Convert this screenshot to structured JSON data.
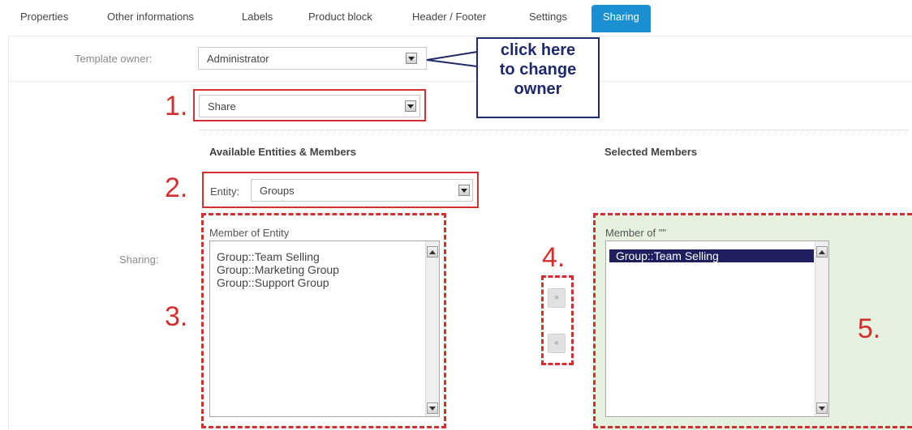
{
  "tabs": [
    "Properties",
    "Other informations",
    "Labels",
    "Product block",
    "Header / Footer",
    "Settings",
    "Sharing"
  ],
  "owner": {
    "label": "Template owner:",
    "value": "Administrator"
  },
  "callout": {
    "line1": "click here",
    "line2": "to change",
    "line3": "owner"
  },
  "share_select": {
    "value": "Share"
  },
  "available": {
    "heading": "Available Entities & Members"
  },
  "selected": {
    "heading": "Selected Members"
  },
  "entity": {
    "label": "Entity:",
    "value": "Groups"
  },
  "sharing_label": "Sharing:",
  "member_of_entity": {
    "label": "Member of Entity",
    "items": [
      "Group::Team Selling",
      "Group::Marketing Group",
      "Group::Support Group"
    ]
  },
  "member_of_selected": {
    "label": "Member of \"\"",
    "items": [
      "Group::Team Selling"
    ]
  },
  "move_buttons": {
    "add": "»",
    "remove": "«"
  },
  "annotations": {
    "n1": "1.",
    "n2": "2.",
    "n3": "3.",
    "n4": "4.",
    "n5": "5."
  },
  "colors": {
    "accent": "#1a8fd1",
    "annotation_red": "#d32f2f",
    "callout_navy": "#1f2a6b",
    "selected_bg": "#e6f1df"
  }
}
